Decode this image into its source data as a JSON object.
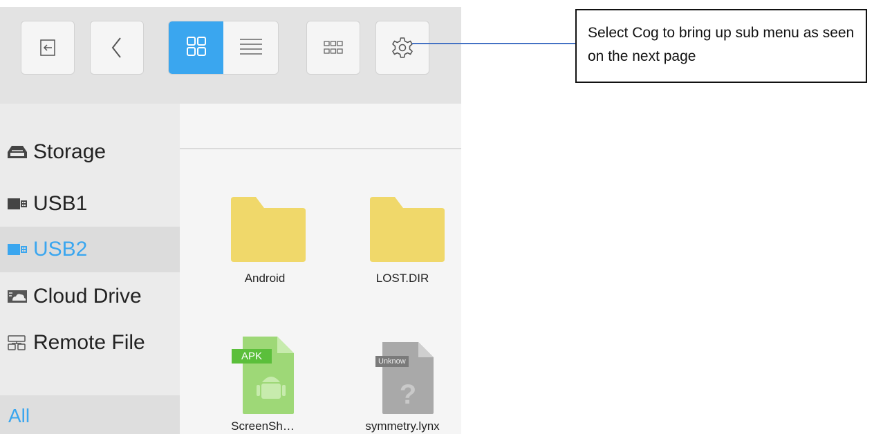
{
  "toolbar": {
    "buttons": [
      "exit-icon",
      "back-icon",
      "grid-view-icon",
      "list-view-icon",
      "thumbnail-view-icon",
      "settings-cog-icon"
    ]
  },
  "sidebar": {
    "items": [
      {
        "label": "Storage",
        "icon": "storage-drive-icon"
      },
      {
        "label": "USB1",
        "icon": "usb-icon"
      },
      {
        "label": "USB2",
        "icon": "usb-icon",
        "selected": true
      },
      {
        "label": "Cloud Drive",
        "icon": "cloud-drive-icon"
      },
      {
        "label": "Remote File",
        "icon": "remote-file-icon"
      }
    ],
    "footer_label": "All"
  },
  "files": [
    {
      "name": "Android",
      "type": "folder"
    },
    {
      "name": "LOST.DIR",
      "type": "folder"
    },
    {
      "name": "ScreenSh…Pro.apk",
      "type": "apk",
      "badge": "APK"
    },
    {
      "name": "symmetry.lynx",
      "type": "unknown",
      "badge": "Unknow"
    }
  ],
  "callout": {
    "text": "Select Cog to bring up sub menu as seen on the next page"
  },
  "colors": {
    "accent": "#3aa6ef",
    "folder": "#f0d86a",
    "apk": "#9ed877",
    "unknown": "#a9a9a9",
    "callout_line": "#4472c4"
  }
}
